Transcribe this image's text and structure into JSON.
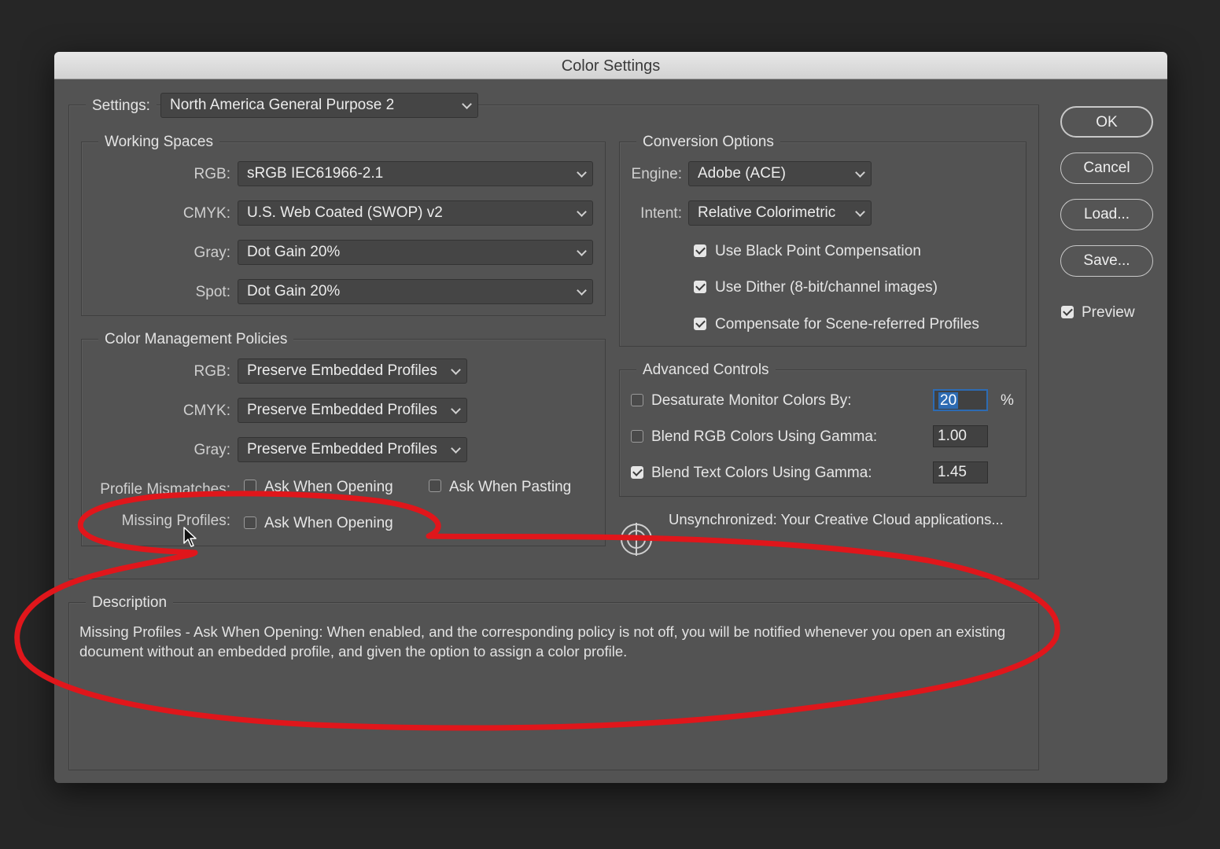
{
  "title": "Color Settings",
  "settings": {
    "label": "Settings:",
    "value": "North America General Purpose 2"
  },
  "working_spaces": {
    "legend": "Working Spaces",
    "rgb": {
      "label": "RGB:",
      "value": "sRGB IEC61966-2.1"
    },
    "cmyk": {
      "label": "CMYK:",
      "value": "U.S. Web Coated (SWOP) v2"
    },
    "gray": {
      "label": "Gray:",
      "value": "Dot Gain 20%"
    },
    "spot": {
      "label": "Spot:",
      "value": "Dot Gain 20%"
    }
  },
  "policies": {
    "legend": "Color Management Policies",
    "rgb": {
      "label": "RGB:",
      "value": "Preserve Embedded Profiles"
    },
    "cmyk": {
      "label": "CMYK:",
      "value": "Preserve Embedded Profiles"
    },
    "gray": {
      "label": "Gray:",
      "value": "Preserve Embedded Profiles"
    },
    "mismatches": {
      "label": "Profile Mismatches:",
      "ask_opening": "Ask When Opening",
      "ask_pasting": "Ask When Pasting"
    },
    "missing": {
      "label": "Missing Profiles:",
      "ask_opening": "Ask When Opening"
    }
  },
  "conversion": {
    "legend": "Conversion Options",
    "engine": {
      "label": "Engine:",
      "value": "Adobe (ACE)"
    },
    "intent": {
      "label": "Intent:",
      "value": "Relative Colorimetric"
    },
    "black_point": {
      "label": "Use Black Point Compensation",
      "checked": true
    },
    "dither": {
      "label": "Use Dither (8-bit/channel images)",
      "checked": true
    },
    "scene": {
      "label": "Compensate for Scene-referred Profiles",
      "checked": true
    }
  },
  "advanced": {
    "legend": "Advanced Controls",
    "desaturate": {
      "label": "Desaturate Monitor Colors By:",
      "value": "20",
      "unit": "%",
      "checked": false
    },
    "blend_rgb": {
      "label": "Blend RGB Colors Using Gamma:",
      "value": "1.00",
      "checked": false
    },
    "blend_text": {
      "label": "Blend Text Colors Using Gamma:",
      "value": "1.45",
      "checked": true
    }
  },
  "sync_status": "Unsynchronized: Your Creative Cloud applications...",
  "description": {
    "legend": "Description",
    "text": "Missing Profiles - Ask When Opening:  When enabled, and the corresponding policy is not off, you will be notified whenever you open an existing document without an embedded profile, and given the option to assign a color profile."
  },
  "buttons": {
    "ok": "OK",
    "cancel": "Cancel",
    "load": "Load...",
    "save": "Save..."
  },
  "preview": {
    "label": "Preview",
    "checked": true
  },
  "annotation_color": "#e0161b"
}
